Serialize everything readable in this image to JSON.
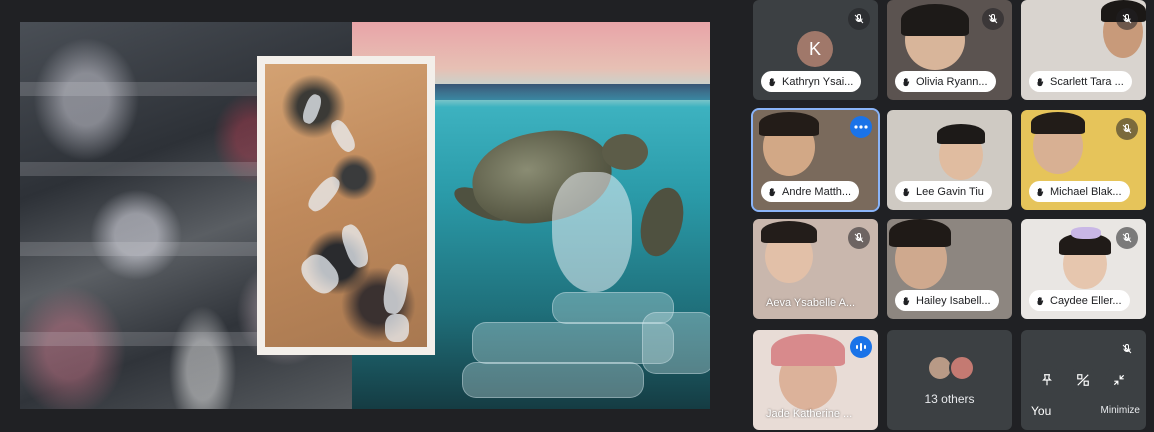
{
  "presentation": {
    "description_label": ""
  },
  "participants": [
    {
      "name": "Kathryn Ysai...",
      "initial": "K",
      "muted": true
    },
    {
      "name": "Olivia Ryann...",
      "muted": true
    },
    {
      "name": "Scarlett Tara ...",
      "muted": true
    },
    {
      "name": "Andre Matth...",
      "muted": false
    },
    {
      "name": "Lee Gavin Tiu",
      "muted": false
    },
    {
      "name": "Michael Blak...",
      "muted": true
    },
    {
      "name": "Aeva Ysabelle A...",
      "muted": true
    },
    {
      "name": "Hailey Isabell...",
      "muted": false
    },
    {
      "name": "Caydee Eller...",
      "muted": true
    },
    {
      "name": "Jade Katherine ...",
      "muted": false
    }
  ],
  "others": {
    "label": "13 others"
  },
  "self": {
    "label": "You",
    "minimize_label": "Minimize"
  },
  "colors": {
    "accent": "#1a73e8",
    "tile_bg": "#3c4043",
    "page_bg": "#202124",
    "active_outline": "#8ab4f8"
  }
}
